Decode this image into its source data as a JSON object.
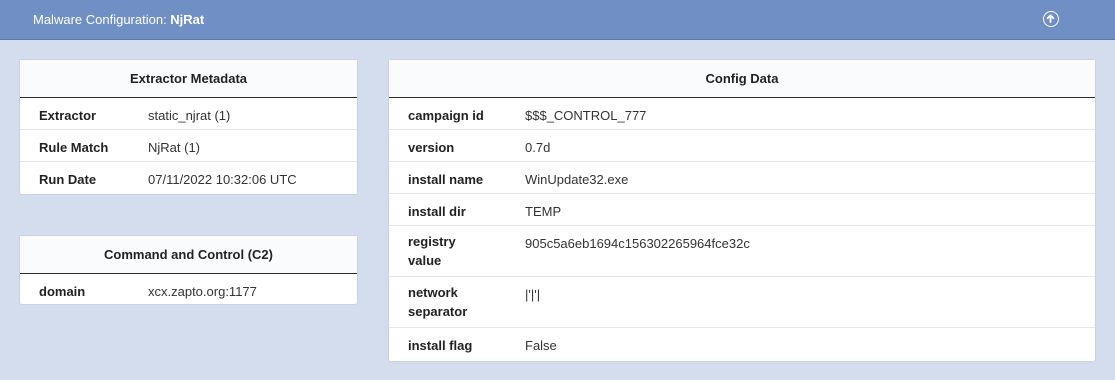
{
  "header": {
    "title_prefix": "Malware Configuration: ",
    "title_family": "NjRat",
    "icon": "arrow-up-circle-icon"
  },
  "extractor_metadata": {
    "title": "Extractor Metadata",
    "rows": [
      {
        "key": "Extractor",
        "value": "static_njrat (1)"
      },
      {
        "key": "Rule Match",
        "value": "NjRat (1)"
      },
      {
        "key": "Run Date",
        "value": "07/11/2022 10:32:06 UTC"
      }
    ]
  },
  "c2": {
    "title": "Command and Control (C2)",
    "rows": [
      {
        "key": "domain",
        "value": "xcx.zapto.org:1177"
      }
    ]
  },
  "config_data": {
    "title": "Config Data",
    "rows": [
      {
        "key": "campaign id",
        "value": "$$$_CONTROL_777"
      },
      {
        "key": "version",
        "value": "0.7d"
      },
      {
        "key": "install name",
        "value": "WinUpdate32.exe"
      },
      {
        "key": "install dir",
        "value": "TEMP"
      },
      {
        "key": "registry value",
        "value": "905c5a6eb1694c156302265964fce32c"
      },
      {
        "key": "network separator",
        "value": "|'|'|"
      },
      {
        "key": "install flag",
        "value": "False"
      }
    ]
  },
  "colors": {
    "header_bg": "#6f8fc5",
    "page_bg": "#d3ddee",
    "card_bg": "#ffffff"
  }
}
